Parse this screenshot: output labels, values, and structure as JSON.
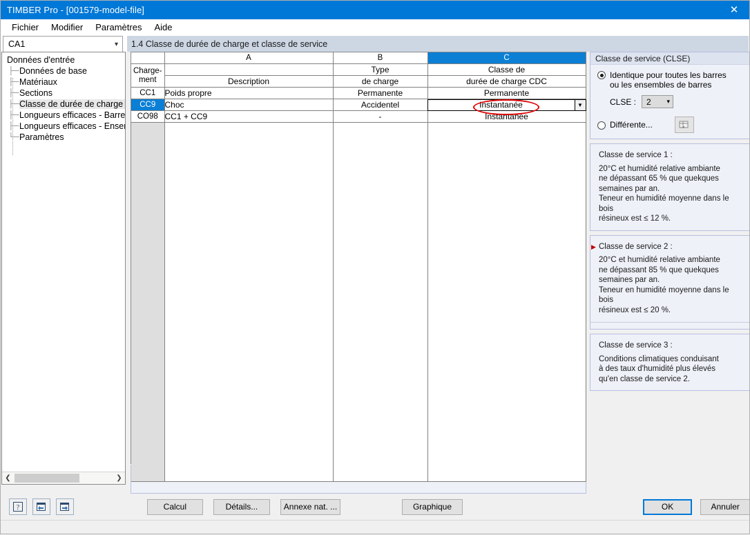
{
  "window": {
    "title": "TIMBER Pro - [001579-model-file]",
    "close_icon": "close-icon"
  },
  "menubar": {
    "items": [
      {
        "label": "Fichier"
      },
      {
        "label": "Modifier"
      },
      {
        "label": "Paramètres"
      },
      {
        "label": "Aide"
      }
    ]
  },
  "subbar": {
    "case_combo_value": "CA1",
    "case_combo_chevron": "chevron-down-icon",
    "section_title": "1.4 Classe de durée de charge et classe de service"
  },
  "tree": {
    "root": "Données d'entrée",
    "items": [
      {
        "label": "Données de base",
        "selected": false
      },
      {
        "label": "Matériaux",
        "selected": false
      },
      {
        "label": "Sections",
        "selected": false
      },
      {
        "label": "Classe de durée de charge et c",
        "selected": true
      },
      {
        "label": "Longueurs efficaces - Barres",
        "selected": false
      },
      {
        "label": "Longueurs efficaces - Ensembl",
        "selected": false
      },
      {
        "label": "Paramètres",
        "selected": false
      }
    ],
    "scroll_left_icon": "chevron-left-icon",
    "scroll_right_icon": "chevron-right-icon"
  },
  "table": {
    "column_letters": [
      "A",
      "B",
      "C"
    ],
    "active_column": "C",
    "corner_header_line1": "Charge-",
    "corner_header_line2": "ment",
    "headers": [
      {
        "line1": "",
        "line2": "Description"
      },
      {
        "line1": "Type",
        "line2": "de charge"
      },
      {
        "line1": "Classe de",
        "line2": "durée de charge CDC"
      }
    ],
    "rows": [
      {
        "id": "CC1",
        "selected": false,
        "description": "Poids propre",
        "type": "Permanente",
        "cdc": "Permanente",
        "editing": false
      },
      {
        "id": "CC9",
        "selected": true,
        "description": "Choc",
        "type": "Accidentel",
        "cdc": "Instantanée",
        "editing": true,
        "dropdown_icon": "dropdown-arrow-icon"
      },
      {
        "id": "CO98",
        "selected": false,
        "description": "CC1 + CC9",
        "type": "-",
        "cdc": "Instantanée",
        "editing": false
      }
    ],
    "annotation_color": "#e00000"
  },
  "service_class": {
    "group_title": "Classe de service (CLSE)",
    "option_same_line1": "Identique pour toutes les barres",
    "option_same_line2": "ou les ensembles de barres",
    "option_same_selected": true,
    "clse_label": "CLSE :",
    "clse_value": "2",
    "clse_chevron": "chevron-down-icon",
    "option_diff_label": "Différente...",
    "option_diff_selected": false,
    "diff_button_icon": "table-edit-icon"
  },
  "info_boxes": [
    {
      "heading": "Classe de service 1 :",
      "body": "20°C et humidité relative ambiante\nne dépassant 65 % que quekques\nsemaines par an.\nTeneur en humidité moyenne dans le bois\nrésineux est ≤ 12 %.",
      "marked": false
    },
    {
      "heading": "Classe de service 2 :",
      "body": "20°C et humidité relative ambiante\nne dépassant 85 % que quekques\nsemaines par an.\nTeneur en humidité moyenne dans le bois\nrésineux est ≤ 20 %.",
      "marked": true
    },
    {
      "heading": "Classe de service 3 :",
      "body": "Conditions climatiques conduisant\nà des taux d'humidité plus élevés\nqu'en classe de service 2.",
      "marked": false
    }
  ],
  "bottombar": {
    "help_icon": "help-question-icon",
    "prev_icon": "previous-panel-icon",
    "next_icon": "next-panel-icon",
    "calcul_label": "Calcul",
    "details_label": "Détails...",
    "annexe_label": "Annexe nat. ...",
    "graphique_label": "Graphique",
    "ok_label": "OK",
    "cancel_label": "Annuler"
  },
  "colors": {
    "title_bar": "#0078d7",
    "accent": "#0b7fd4",
    "annotation_red": "#e00000",
    "section_title_bg": "#cdd6e3",
    "panel_bg": "#eef1f8"
  }
}
